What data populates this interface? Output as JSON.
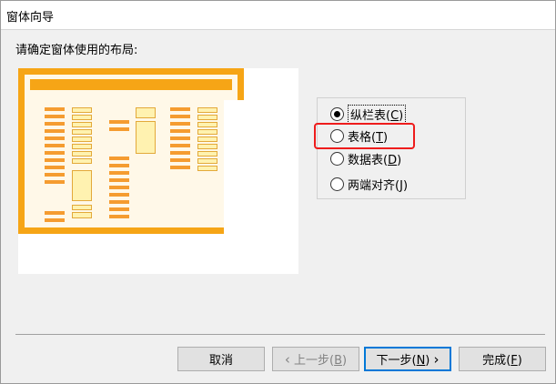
{
  "window": {
    "title": "窗体向导"
  },
  "prompt": "请确定窗体使用的布局:",
  "layout_options": {
    "items": [
      {
        "label": "纵栏表",
        "key": "C",
        "selected": true
      },
      {
        "label": "表格",
        "key": "T",
        "selected": false
      },
      {
        "label": "数据表",
        "key": "D",
        "selected": false
      },
      {
        "label": "两端对齐",
        "key": "J",
        "selected": false
      }
    ]
  },
  "buttons": {
    "cancel": {
      "label": "取消"
    },
    "back": {
      "label": "上一步",
      "key": "B",
      "icon": "chevron-left-icon"
    },
    "next": {
      "label": "下一步",
      "key": "N",
      "icon": "chevron-right-icon"
    },
    "finish": {
      "label": "完成",
      "key": "F"
    }
  },
  "colors": {
    "accent": "#f6a516",
    "highlight_box": "#ee1c1c",
    "focus_border": "#0078d7"
  }
}
